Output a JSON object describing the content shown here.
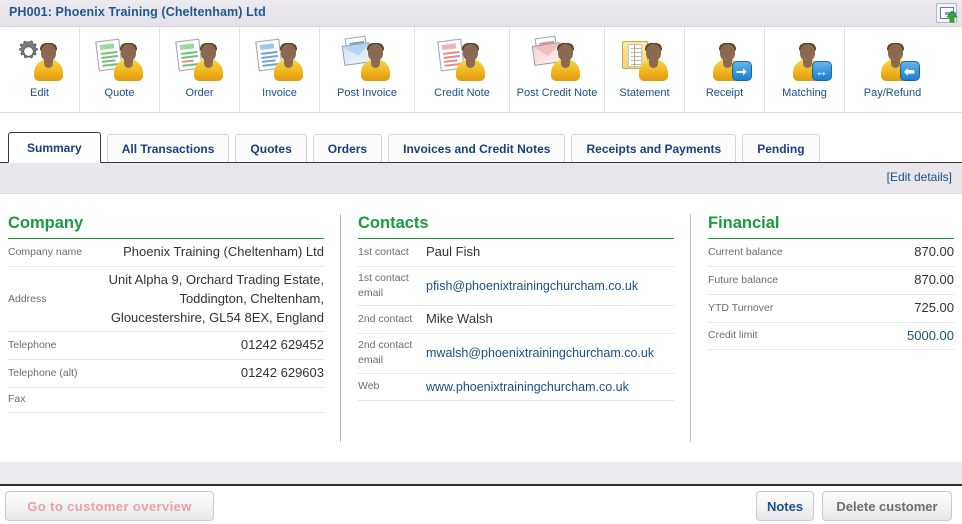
{
  "window": {
    "title": "PH001: Phoenix Training (Cheltenham) Ltd",
    "restore_icon": "window-restore-icon"
  },
  "toolbar": {
    "items": [
      {
        "label": "Edit",
        "icon": "edit-customer-icon"
      },
      {
        "label": "Quote",
        "icon": "quote-document-icon"
      },
      {
        "label": "Order",
        "icon": "order-document-icon"
      },
      {
        "label": "Invoice",
        "icon": "invoice-document-icon"
      },
      {
        "label": "Post Invoice",
        "icon": "post-invoice-envelope-icon"
      },
      {
        "label": "Credit Note",
        "icon": "credit-note-document-icon"
      },
      {
        "label": "Post Credit Note",
        "icon": "post-credit-note-envelope-icon"
      },
      {
        "label": "Statement",
        "icon": "statement-folder-icon"
      },
      {
        "label": "Receipt",
        "icon": "receipt-arrow-right-icon"
      },
      {
        "label": "Matching",
        "icon": "matching-arrow-both-icon"
      },
      {
        "label": "Pay/Refund",
        "icon": "pay-refund-arrow-left-icon"
      }
    ]
  },
  "tabs": {
    "active": "Summary",
    "items": [
      {
        "label": "Summary"
      },
      {
        "label": "All Transactions"
      },
      {
        "label": "Quotes"
      },
      {
        "label": "Orders"
      },
      {
        "label": "Invoices and Credit Notes"
      },
      {
        "label": "Receipts and Payments"
      },
      {
        "label": "Pending"
      }
    ]
  },
  "subbar": {
    "edit_details_label": "[Edit details]"
  },
  "company": {
    "heading": "Company",
    "rows": [
      {
        "key": "Company name",
        "value": "Phoenix Training (Cheltenham) Ltd"
      },
      {
        "key": "Address",
        "value": "Unit Alpha 9, Orchard Trading Estate, Toddington, Cheltenham, Gloucestershire, GL54 8EX, England"
      },
      {
        "key": "Telephone",
        "value": "01242 629452"
      },
      {
        "key": "Telephone (alt)",
        "value": "01242 629603"
      },
      {
        "key": "Fax",
        "value": ""
      }
    ]
  },
  "contacts": {
    "heading": "Contacts",
    "rows": [
      {
        "key": "1st contact",
        "value": "Paul Fish",
        "link": false
      },
      {
        "key": "1st contact email",
        "value": "pfish@phoenixtrainingchurcham.co.uk",
        "link": true
      },
      {
        "key": "2nd contact",
        "value": "Mike Walsh",
        "link": false
      },
      {
        "key": "2nd contact email",
        "value": "mwalsh@phoenixtrainingchurcham.co.uk",
        "link": true
      },
      {
        "key": "Web",
        "value": "www.phoenixtrainingchurcham.co.uk",
        "link": true
      }
    ]
  },
  "financial": {
    "heading": "Financial",
    "rows": [
      {
        "key": "Current balance",
        "value": "870.00",
        "highlight": false
      },
      {
        "key": "Future balance",
        "value": "870.00",
        "highlight": false
      },
      {
        "key": "YTD Turnover",
        "value": "725.00",
        "highlight": false
      },
      {
        "key": "Credit limit",
        "value": "5000.00",
        "highlight": true
      }
    ]
  },
  "footer": {
    "overview_label": "Go to customer overview",
    "notes_label": "Notes",
    "delete_label": "Delete customer"
  },
  "colors": {
    "title_blue": "#1a5a8e",
    "tab_blue": "#1c3f7a",
    "heading_green": "#1a9c3c",
    "link_blue": "#1b4f8a",
    "disabled_gray": "#6e6e6e",
    "overview_pink": "#eaa0a6",
    "titlebar_bg": "#e8e6ec",
    "subbar_bg": "#e9e7ec"
  }
}
